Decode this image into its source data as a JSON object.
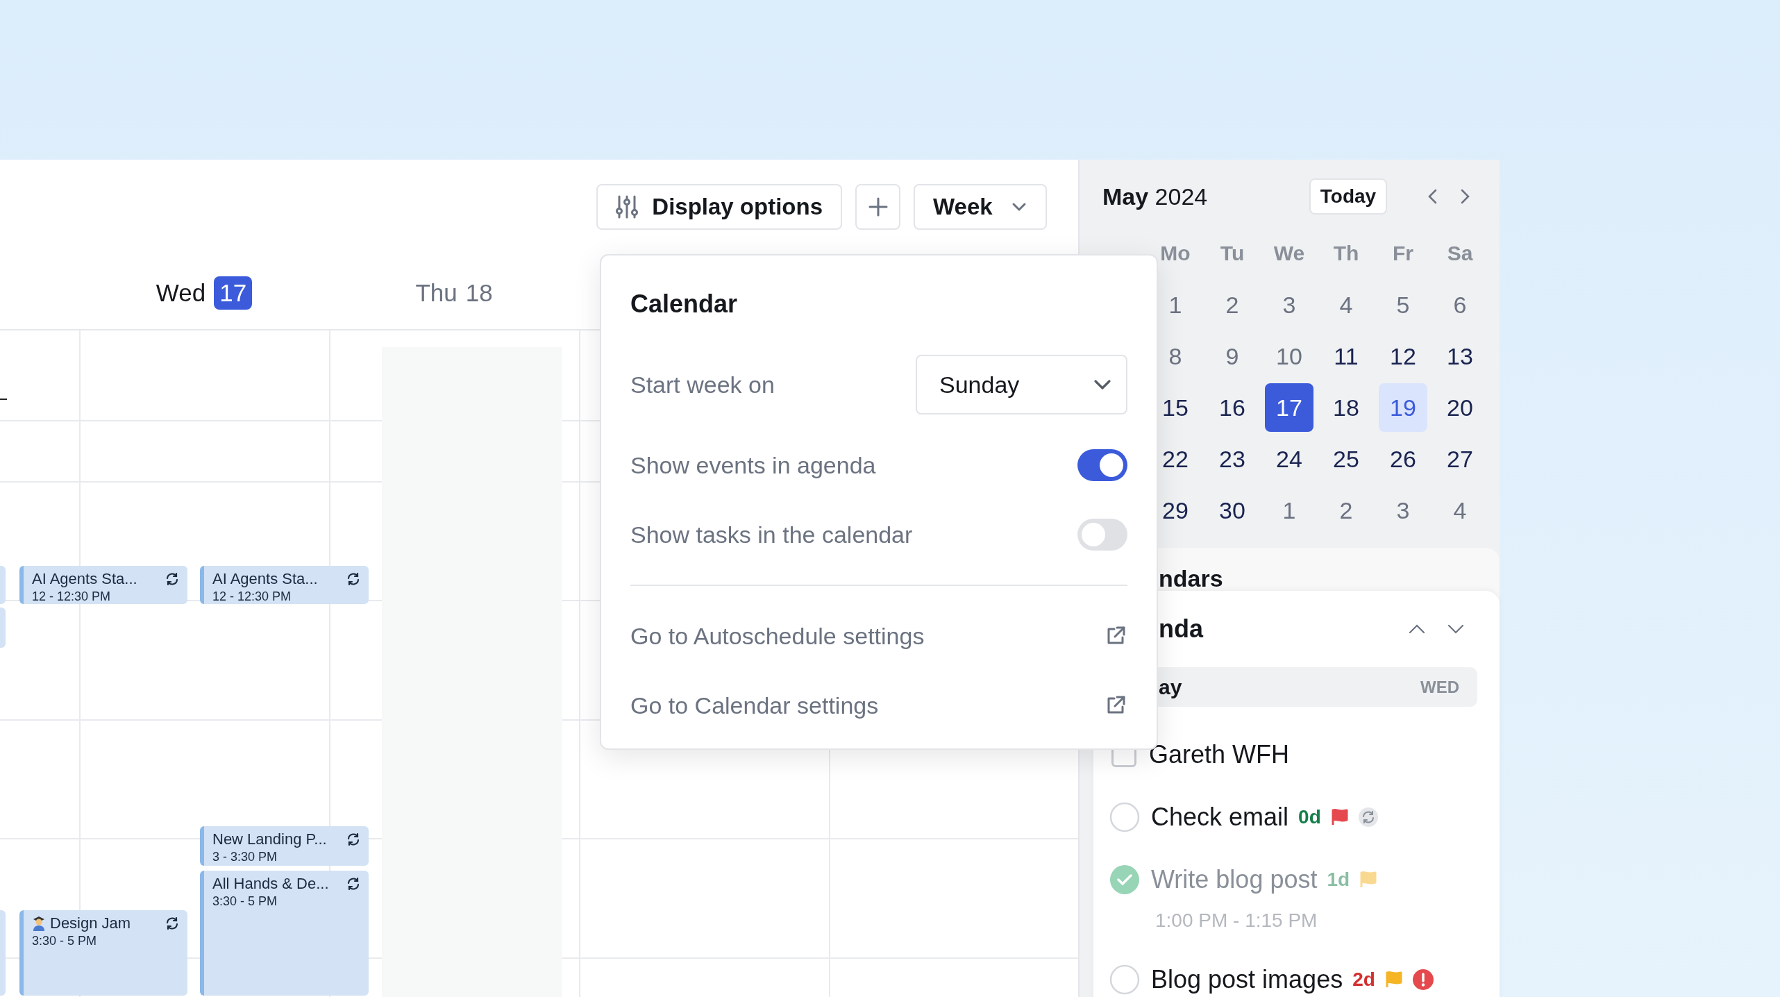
{
  "toolbar": {
    "display_options": "Display options",
    "view": "Week"
  },
  "days": [
    {
      "weekday": "Wed",
      "date": "17",
      "selected": true
    },
    {
      "weekday": "Thu",
      "date": "18",
      "selected": false
    }
  ],
  "events": [
    {
      "title": "AI Agents Sta...",
      "time": "12 - 12:30 PM",
      "recurring": true
    },
    {
      "title": "AI Agents Sta...",
      "time": "12 - 12:30 PM",
      "recurring": true
    },
    {
      "title": "New Landing P...",
      "time": "3 - 3:30 PM",
      "recurring": true
    },
    {
      "title": "All Hands & De...",
      "time": "3:30 - 5 PM",
      "recurring": true
    },
    {
      "title": "Design Jam",
      "time": "3:30 - 5 PM",
      "recurring": true
    }
  ],
  "popup": {
    "title": "Calendar",
    "start_week": {
      "label": "Start week on",
      "value": "Sunday"
    },
    "toggles": [
      {
        "label": "Show events in agenda",
        "on": true
      },
      {
        "label": "Show tasks in the calendar",
        "on": false
      }
    ],
    "links": [
      "Go to Autoschedule settings",
      "Go to Calendar settings"
    ]
  },
  "mini_calendar": {
    "month": "May",
    "year": "2024",
    "today": "Today",
    "weekdays": [
      "Mo",
      "Tu",
      "We",
      "Th",
      "Fr",
      "Sa"
    ],
    "days": [
      {
        "day": "1",
        "muted": true,
        "selected": false,
        "highlighted": false
      },
      {
        "day": "2",
        "muted": true,
        "selected": false,
        "highlighted": false
      },
      {
        "day": "3",
        "muted": true,
        "selected": false,
        "highlighted": false
      },
      {
        "day": "4",
        "muted": true,
        "selected": false,
        "highlighted": false
      },
      {
        "day": "5",
        "muted": true,
        "selected": false,
        "highlighted": false
      },
      {
        "day": "6",
        "muted": true,
        "selected": false,
        "highlighted": false
      },
      {
        "day": "8",
        "muted": true,
        "selected": false,
        "highlighted": false
      },
      {
        "day": "9",
        "muted": true,
        "selected": false,
        "highlighted": false
      },
      {
        "day": "10",
        "muted": true,
        "selected": false,
        "highlighted": false
      },
      {
        "day": "11",
        "muted": false,
        "selected": false,
        "highlighted": false
      },
      {
        "day": "12",
        "muted": false,
        "selected": false,
        "highlighted": false
      },
      {
        "day": "13",
        "muted": false,
        "selected": false,
        "highlighted": false
      },
      {
        "day": "15",
        "muted": false,
        "selected": false,
        "highlighted": false
      },
      {
        "day": "16",
        "muted": false,
        "selected": false,
        "highlighted": false
      },
      {
        "day": "17",
        "muted": false,
        "selected": true,
        "highlighted": false
      },
      {
        "day": "18",
        "muted": false,
        "selected": false,
        "highlighted": false
      },
      {
        "day": "19",
        "muted": false,
        "selected": false,
        "highlighted": true
      },
      {
        "day": "20",
        "muted": false,
        "selected": false,
        "highlighted": false
      },
      {
        "day": "22",
        "muted": false,
        "selected": false,
        "highlighted": false
      },
      {
        "day": "23",
        "muted": false,
        "selected": false,
        "highlighted": false
      },
      {
        "day": "24",
        "muted": false,
        "selected": false,
        "highlighted": false
      },
      {
        "day": "25",
        "muted": false,
        "selected": false,
        "highlighted": false
      },
      {
        "day": "26",
        "muted": false,
        "selected": false,
        "highlighted": false
      },
      {
        "day": "27",
        "muted": false,
        "selected": false,
        "highlighted": false
      },
      {
        "day": "29",
        "muted": false,
        "selected": false,
        "highlighted": false
      },
      {
        "day": "30",
        "muted": false,
        "selected": false,
        "highlighted": false
      },
      {
        "day": "1",
        "muted": true,
        "selected": false,
        "highlighted": false
      },
      {
        "day": "2",
        "muted": true,
        "selected": false,
        "highlighted": false
      },
      {
        "day": "3",
        "muted": true,
        "selected": false,
        "highlighted": false
      },
      {
        "day": "4",
        "muted": true,
        "selected": false,
        "highlighted": false
      }
    ]
  },
  "calendars_heading": "ndars",
  "agenda": {
    "title": "nda",
    "date_label": "ay",
    "weekday": "WED",
    "items": [
      {
        "kind": "event",
        "title": "Gareth WFH",
        "checked": false
      },
      {
        "kind": "task",
        "title": "Check email",
        "checked": false,
        "due": "0d",
        "overdue": false,
        "high_priority": true,
        "recurring": true,
        "urgent": false
      },
      {
        "kind": "task",
        "title": "Write blog post",
        "checked": true,
        "due": "1d",
        "overdue": false,
        "high_priority": false,
        "recurring": false,
        "urgent": false,
        "time": "1:00 PM - 1:15 PM"
      },
      {
        "kind": "task",
        "title": "Blog post images",
        "checked": false,
        "due": "2d",
        "overdue": true,
        "high_priority": false,
        "recurring": false,
        "urgent": true
      }
    ]
  }
}
